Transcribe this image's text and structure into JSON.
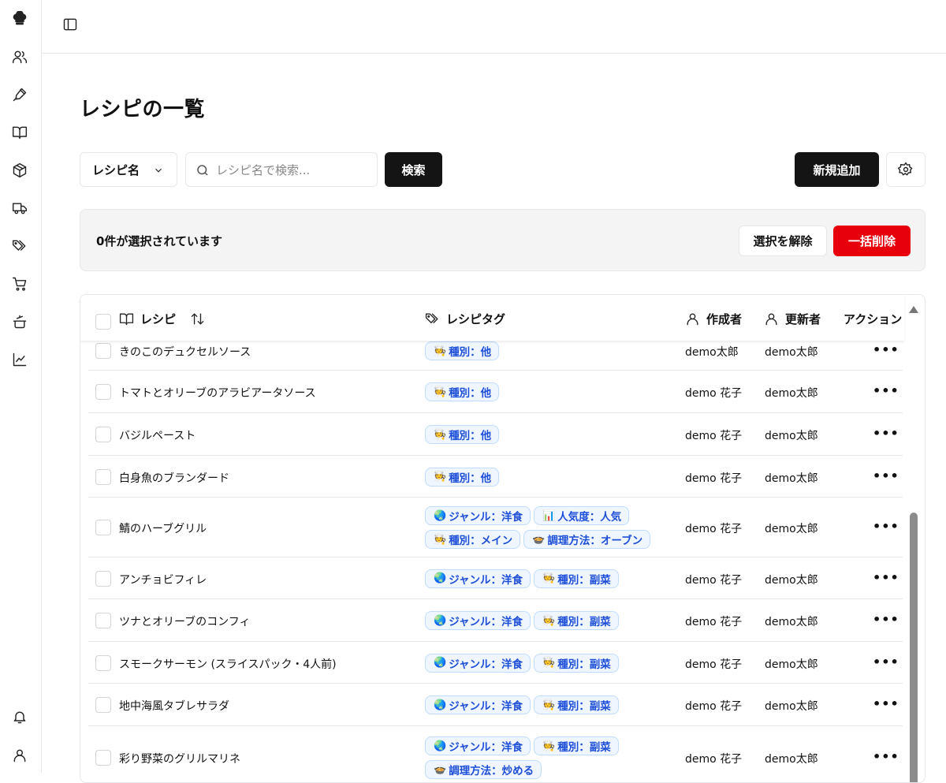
{
  "sidebar": {
    "items": [
      {
        "name": "chef-hat-icon"
      },
      {
        "name": "users-icon"
      },
      {
        "name": "pen-icon"
      },
      {
        "name": "book-icon"
      },
      {
        "name": "box-icon"
      },
      {
        "name": "truck-icon"
      },
      {
        "name": "tags-icon"
      },
      {
        "name": "cart-icon"
      },
      {
        "name": "cooking-pot-icon"
      },
      {
        "name": "chart-icon"
      },
      {
        "name": "bell-icon"
      },
      {
        "name": "user-icon"
      }
    ]
  },
  "page": {
    "title": "レシピの一覧"
  },
  "filter": {
    "select_value": "レシピ名",
    "search_placeholder": "レシピ名で検索...",
    "search_button": "検索",
    "add_button": "新規追加"
  },
  "selection": {
    "status": "0件が選択されています",
    "clear_button": "選択を解除",
    "delete_button": "一括削除"
  },
  "table": {
    "headers": {
      "recipe": "レシピ",
      "tags": "レシピタグ",
      "author": "作成者",
      "editor": "更新者",
      "actions": "アクション"
    },
    "rows": [
      {
        "name": "きのこのデュクセルソース",
        "tags": [
          {
            "emoji": "🧑‍🍳",
            "label": "種別：他"
          }
        ],
        "author": "demo太郎",
        "editor": "demo太郎"
      },
      {
        "name": "トマトとオリーブのアラビアータソース",
        "tags": [
          {
            "emoji": "🧑‍🍳",
            "label": "種別：他"
          }
        ],
        "author": "demo 花子",
        "editor": "demo太郎"
      },
      {
        "name": "バジルペースト",
        "tags": [
          {
            "emoji": "🧑‍🍳",
            "label": "種別：他"
          }
        ],
        "author": "demo 花子",
        "editor": "demo太郎"
      },
      {
        "name": "白身魚のブランダード",
        "tags": [
          {
            "emoji": "🧑‍🍳",
            "label": "種別：他"
          }
        ],
        "author": "demo 花子",
        "editor": "demo太郎"
      },
      {
        "name": "鯖のハーブグリル",
        "tags": [
          {
            "emoji": "🌏",
            "label": "ジャンル：洋食"
          },
          {
            "emoji": "📊",
            "label": "人気度：人気"
          },
          {
            "emoji": "🧑‍🍳",
            "label": "種別：メイン"
          },
          {
            "emoji": "🍲",
            "label": "調理方法：オーブン"
          }
        ],
        "author": "demo 花子",
        "editor": "demo太郎"
      },
      {
        "name": "アンチョビフィレ",
        "tags": [
          {
            "emoji": "🌏",
            "label": "ジャンル：洋食"
          },
          {
            "emoji": "🧑‍🍳",
            "label": "種別：副菜"
          }
        ],
        "author": "demo 花子",
        "editor": "demo太郎"
      },
      {
        "name": "ツナとオリーブのコンフィ",
        "tags": [
          {
            "emoji": "🌏",
            "label": "ジャンル：洋食"
          },
          {
            "emoji": "🧑‍🍳",
            "label": "種別：副菜"
          }
        ],
        "author": "demo 花子",
        "editor": "demo太郎"
      },
      {
        "name": "スモークサーモン (スライスパック・4人前)",
        "tags": [
          {
            "emoji": "🌏",
            "label": "ジャンル：洋食"
          },
          {
            "emoji": "🧑‍🍳",
            "label": "種別：副菜"
          }
        ],
        "author": "demo 花子",
        "editor": "demo太郎"
      },
      {
        "name": "地中海風タブレサラダ",
        "tags": [
          {
            "emoji": "🌏",
            "label": "ジャンル：洋食"
          },
          {
            "emoji": "🧑‍🍳",
            "label": "種別：副菜"
          }
        ],
        "author": "demo 花子",
        "editor": "demo太郎"
      },
      {
        "name": "彩り野菜のグリルマリネ",
        "tags": [
          {
            "emoji": "🌏",
            "label": "ジャンル：洋食"
          },
          {
            "emoji": "🧑‍🍳",
            "label": "種別：副菜"
          },
          {
            "emoji": "🍲",
            "label": "調理方法：炒める"
          }
        ],
        "author": "demo 花子",
        "editor": "demo太郎"
      }
    ]
  }
}
